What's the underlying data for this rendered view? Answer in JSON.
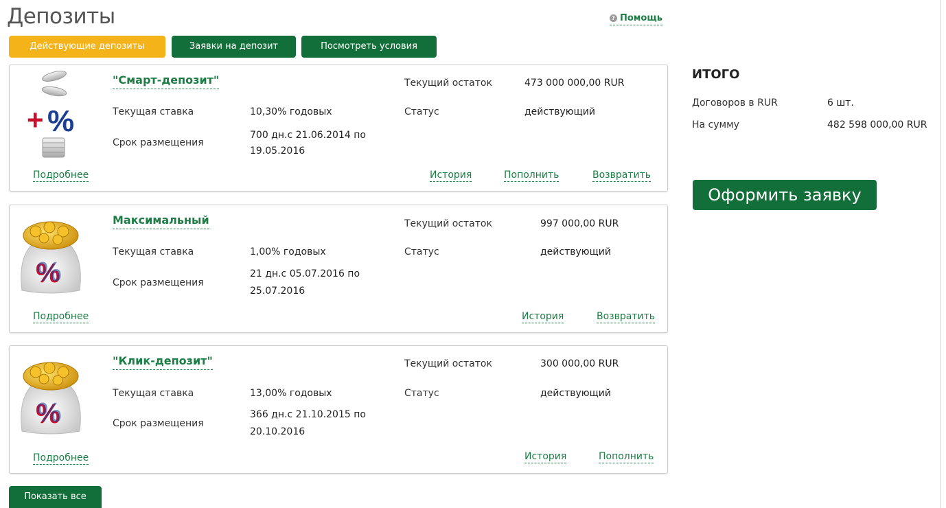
{
  "header": {
    "title": "Депозиты",
    "help_label": "Помощь"
  },
  "tabs": [
    {
      "label": "Действующие депозиты",
      "active": true
    },
    {
      "label": "Заявки на депозит",
      "active": false
    },
    {
      "label": "Посмотреть условия",
      "active": false
    }
  ],
  "labels": {
    "rate": "Текущая ставка",
    "term": "Срок размещения",
    "balance": "Текущий остаток",
    "status": "Статус",
    "details": "Подробнее"
  },
  "deposits": [
    {
      "name": "\"Смарт-депозит\"",
      "icon": "coins-percent-icon",
      "rate": "10,30% годовых",
      "term_line1": "700 дн.с 21.06.2014 по",
      "term_line2": "19.05.2016",
      "balance": "473 000 000,00 RUR",
      "status": "действующий",
      "actions": [
        "История",
        "Пополнить",
        "Возвратить"
      ]
    },
    {
      "name": "Максимальный",
      "icon": "money-bag-percent-icon",
      "rate": "1,00% годовых",
      "term_line1": "21 дн.с 05.07.2016 по",
      "term_line2": "25.07.2016",
      "balance": "997 000,00 RUR",
      "status": "действующий",
      "actions": [
        "История",
        "Возвратить"
      ]
    },
    {
      "name": "\"Клик-депозит\"",
      "icon": "money-bag-percent-icon",
      "rate": "13,00% годовых",
      "term_line1": "366 дн.с 21.10.2015 по",
      "term_line2": "20.10.2016",
      "balance": "300 000,00 RUR",
      "status": "действующий",
      "actions": [
        "История",
        "Пополнить"
      ]
    }
  ],
  "summary": {
    "title": "ИТОГО",
    "contracts_label": "Договоров в RUR",
    "contracts_value": "6 шт.",
    "sum_label": "На сумму",
    "sum_value": "482 598 000,00 RUR"
  },
  "buttons": {
    "apply": "Оформить заявку",
    "show_all": "Показать все"
  },
  "colors": {
    "brand_green": "#136f3a",
    "link_green": "#1e7c45",
    "active_tab": "#f5b31a"
  }
}
